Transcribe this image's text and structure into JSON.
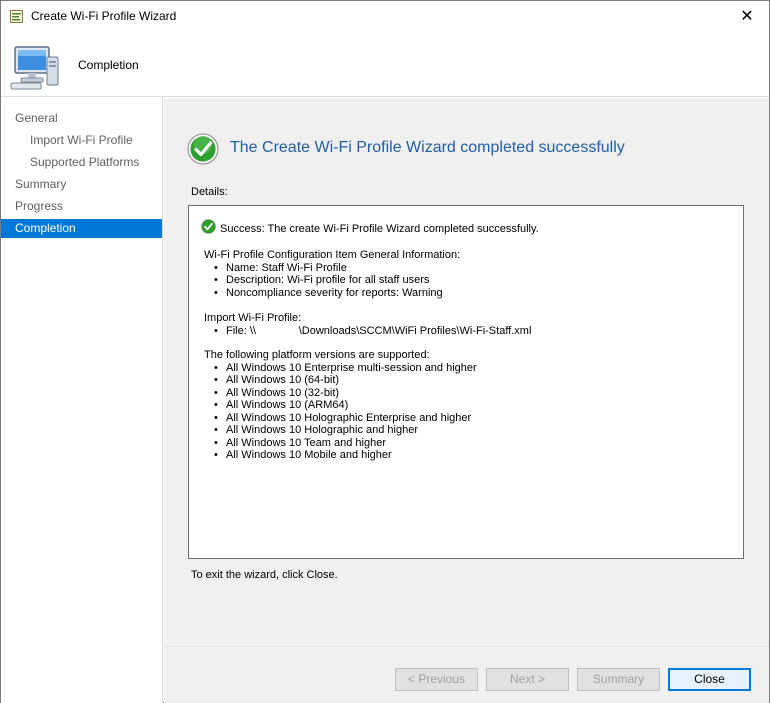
{
  "window": {
    "title": "Create Wi-Fi Profile Wizard",
    "close_glyph": "✕"
  },
  "header": {
    "page_name": "Completion",
    "icon": "computer-icon"
  },
  "nav": {
    "items": [
      {
        "label": "General",
        "level": 1,
        "active": false
      },
      {
        "label": "Import Wi-Fi Profile",
        "level": 2,
        "active": false
      },
      {
        "label": "Supported Platforms",
        "level": 2,
        "active": false
      },
      {
        "label": "Summary",
        "level": 1,
        "active": false
      },
      {
        "label": "Progress",
        "level": 1,
        "active": false
      },
      {
        "label": "Completion",
        "level": 1,
        "active": true
      }
    ]
  },
  "main": {
    "headline": "The Create Wi-Fi Profile Wizard completed successfully",
    "details_label": "Details:",
    "success_text": "Success: The create Wi-Fi Profile Wizard completed successfully.",
    "general_section": {
      "heading": "Wi-Fi Profile Configuration Item General Information:",
      "items": [
        "Name: Staff Wi-Fi Profile",
        "Description: Wi-Fi profile for all staff users",
        "Noncompliance severity for reports: Warning"
      ]
    },
    "import_section": {
      "heading": "Import Wi-Fi Profile:",
      "items": [
        "File: \\\\              \\Downloads\\SCCM\\WiFi Profiles\\Wi-Fi-Staff.xml"
      ]
    },
    "platform_section": {
      "heading": "The following platform versions are supported:",
      "items": [
        "All Windows 10 Enterprise multi-session and higher",
        "All Windows 10 (64-bit)",
        "All Windows 10 (32-bit)",
        "All Windows 10 (ARM64)",
        "All Windows 10 Holographic Enterprise and higher",
        "All Windows 10 Holographic and higher",
        "All Windows 10 Team and higher",
        "All Windows 10 Mobile and higher"
      ]
    },
    "exit_text": "To exit the wizard, click Close."
  },
  "footer": {
    "previous_label": "< Previous",
    "next_label": "Next >",
    "summary_label": "Summary",
    "close_label": "Close"
  },
  "colors": {
    "accent": "#0078d7",
    "headline": "#1f5fa8",
    "success_green": "#2e9e2e"
  }
}
